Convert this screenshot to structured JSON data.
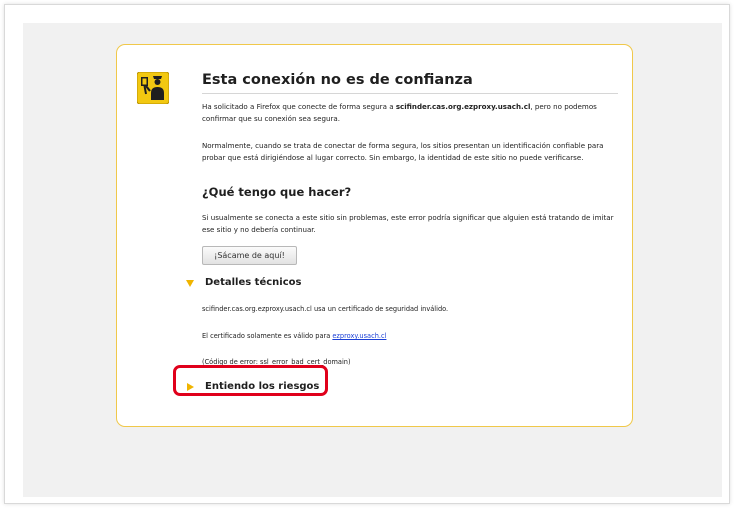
{
  "page": {
    "title": "Esta conexión no es de confianza",
    "intro_prefix": "Ha solicitado a Firefox que conecte de forma segura a ",
    "intro_host": "scifinder.cas.org.ezproxy.usach.cl",
    "intro_suffix": ", pero no podemos confirmar que su conexión sea segura.",
    "normal_text": "Normalmente, cuando se trata de conectar de forma segura, los sitios presentan un identificación confiable para probar que está dirigiéndose al lugar correcto. Sin embargo, la identidad de este sitio no puede verificarse.",
    "what_heading": "¿Qué tengo que hacer?",
    "what_text": "Si usualmente se conecta a este sitio sin problemas, este error podría significar que alguien está tratando de imitar ese sitio y no debería continuar.",
    "get_me_out_label": "¡Sácame de aquí!",
    "technical_label": "Detalles técnicos",
    "tech_line1": "scifinder.cas.org.ezproxy.usach.cl usa un certificado de seguridad inválido.",
    "tech_line2_prefix": "El certificado solamente es válido para ",
    "tech_line2_link": "ezproxy.usach.cl",
    "tech_line3": "(Código de error: ssl_error_bad_cert_domain)",
    "risks_label": "Entiendo los riesgos"
  },
  "icons": {
    "warning": "untrusted-connection-icon",
    "expanded": "triangle-down-icon",
    "collapsed": "triangle-right-icon"
  },
  "colors": {
    "card_border": "#f0c84a",
    "icon_yellow": "#f2c811",
    "link": "#1a3fd6",
    "highlight": "#e0001b"
  }
}
